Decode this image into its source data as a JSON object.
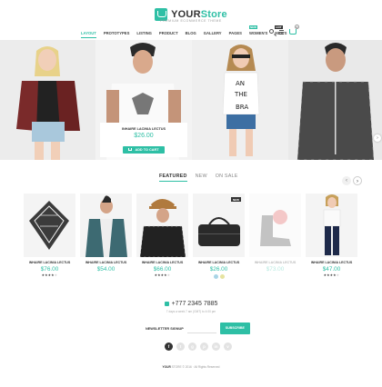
{
  "brand": {
    "name_main": "YOUR",
    "name_accent": "Store",
    "tagline": "PREMIUM ECOMMERCE THEME",
    "accent": "#2ebfa5"
  },
  "nav": [
    {
      "label": "LAYOUT",
      "active": true
    },
    {
      "label": "PROTOTYPES"
    },
    {
      "label": "LISTING"
    },
    {
      "label": "PRODUCT"
    },
    {
      "label": "BLOG"
    },
    {
      "label": "GALLERY"
    },
    {
      "label": "PAGES"
    },
    {
      "label": "WOMEN'S",
      "badge": "NEW"
    },
    {
      "label": "MEN'S",
      "badge": "HOT"
    }
  ],
  "header": {
    "cart_count": "0"
  },
  "hero": {
    "featured_name": "INHAIRE LACINIA LECTUS",
    "featured_price": "$26.00",
    "add_to_cart": "ADD TO CART",
    "next_arrow": "›",
    "shirt_text": [
      "AN",
      "THE",
      "BRA"
    ]
  },
  "tabs": [
    {
      "label": "FEATURED",
      "active": true
    },
    {
      "label": "NEW"
    },
    {
      "label": "ON SALE"
    }
  ],
  "pager": {
    "prev": "‹",
    "next": "›"
  },
  "products": [
    {
      "name": "INHAIRE LACINIA LECTUS",
      "price": "$76.00",
      "stars": "★★★★",
      "stars_off": "★"
    },
    {
      "name": "INHAIRE LACINIA LECTUS",
      "price": "$54.00",
      "stars": "",
      "stars_off": ""
    },
    {
      "name": "INHAIRE LACINIA LECTUS",
      "price": "$66.00",
      "stars": "★★★★",
      "stars_off": "★"
    },
    {
      "name": "INHAIRE LACINIA LECTUS",
      "price": "$26.00",
      "badge": "NEW",
      "swatches": [
        "#a8d4e6",
        "#e6e3a0"
      ]
    },
    {
      "name": "INHAIRE LACINIA LECTUS",
      "price": "$73.00",
      "faded": true
    },
    {
      "name": "INHAIRE LACINIA LECTUS",
      "price": "$47.00",
      "stars": "★★★★",
      "stars_off": "★"
    }
  ],
  "contact": {
    "phone": "+777 2345 7885",
    "sub": "7 days a week 7 am (GMT) to 4:00 pm"
  },
  "newsletter": {
    "label": "NEWSLETTER SIGNUP",
    "placeholder": "",
    "button": "SUBSCRIBE"
  },
  "social": [
    "f",
    "t",
    "g",
    "p",
    "in",
    "v"
  ],
  "footer": {
    "brand": "YOUR",
    "rest": "STORE © 2016 · All Rights Reserved"
  }
}
